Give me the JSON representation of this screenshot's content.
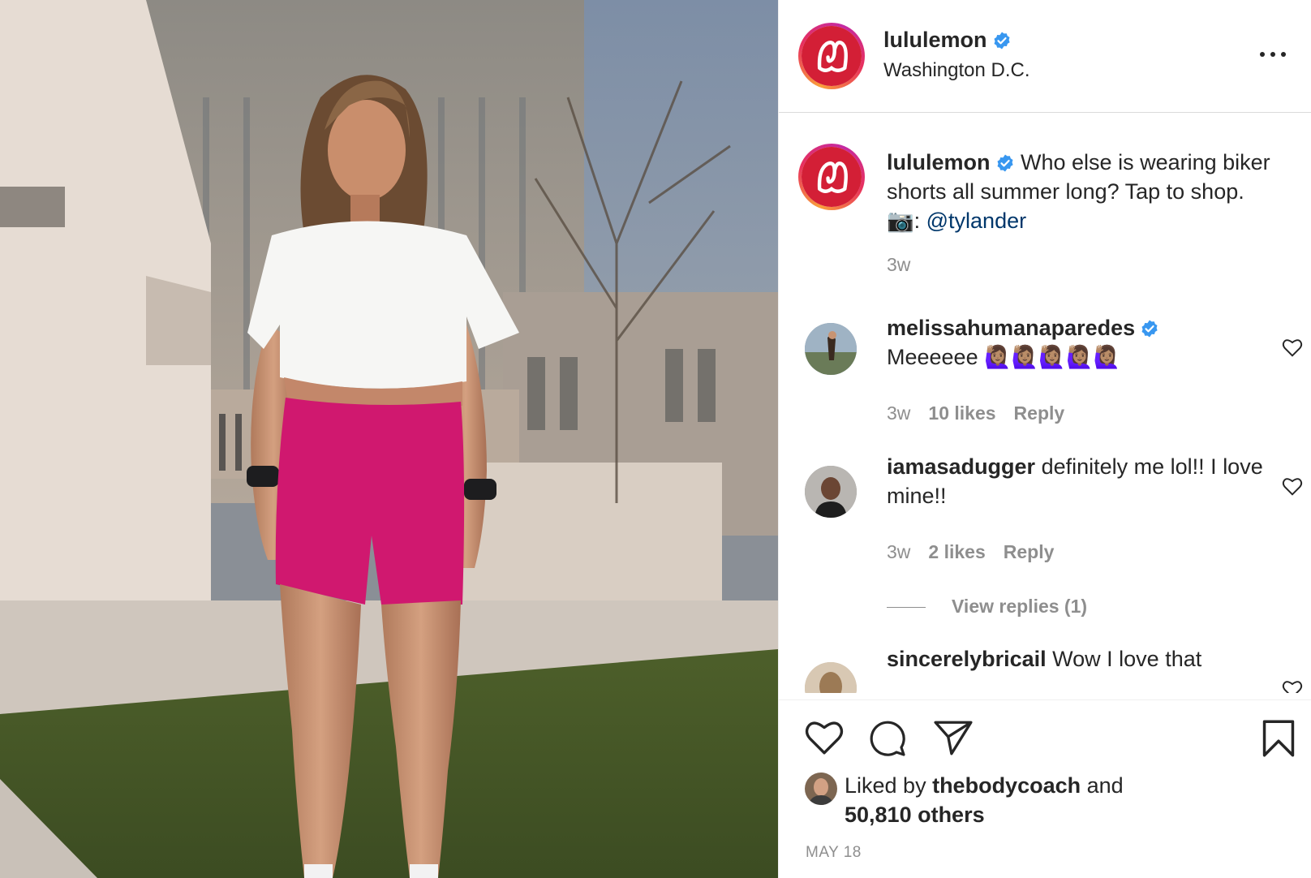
{
  "post": {
    "username": "lululemon",
    "verified": true,
    "location": "Washington D.C.",
    "caption": {
      "text": "Who else is wearing biker shorts all summer long? Tap to shop.",
      "credit_prefix": "📷: ",
      "mention": "@tylander",
      "age": "3w"
    },
    "comments": [
      {
        "username": "melissahumanaparedes",
        "verified": true,
        "text": "Meeeeee 🙋🏽‍♀️🙋🏽‍♀️🙋🏽‍♀️🙋🏽‍♀️🙋🏽‍♀️",
        "age": "3w",
        "likes": "10 likes",
        "reply": "Reply"
      },
      {
        "username": "iamasadugger",
        "verified": false,
        "text": "definitely me lol!! I love mine!!",
        "age": "3w",
        "likes": "2 likes",
        "reply": "Reply",
        "view_replies": "View replies (1)"
      },
      {
        "username": "sincerelybricail",
        "verified": false,
        "text": "Wow I love that"
      }
    ],
    "likes": {
      "prefix": "Liked by ",
      "user": "thebodycoach",
      "middle": " and",
      "others": "50,810 others"
    },
    "date": "MAY 18",
    "icons": {
      "more": "more-options-icon",
      "like": "heart-icon",
      "comment": "comment-icon",
      "share": "paper-plane-icon",
      "save": "bookmark-icon",
      "verified": "verified-badge-icon"
    },
    "colors": {
      "brand_red": "#d31f36",
      "verified_blue": "#3897f0",
      "link": "#00376b",
      "muted": "#8e8e8e"
    }
  }
}
